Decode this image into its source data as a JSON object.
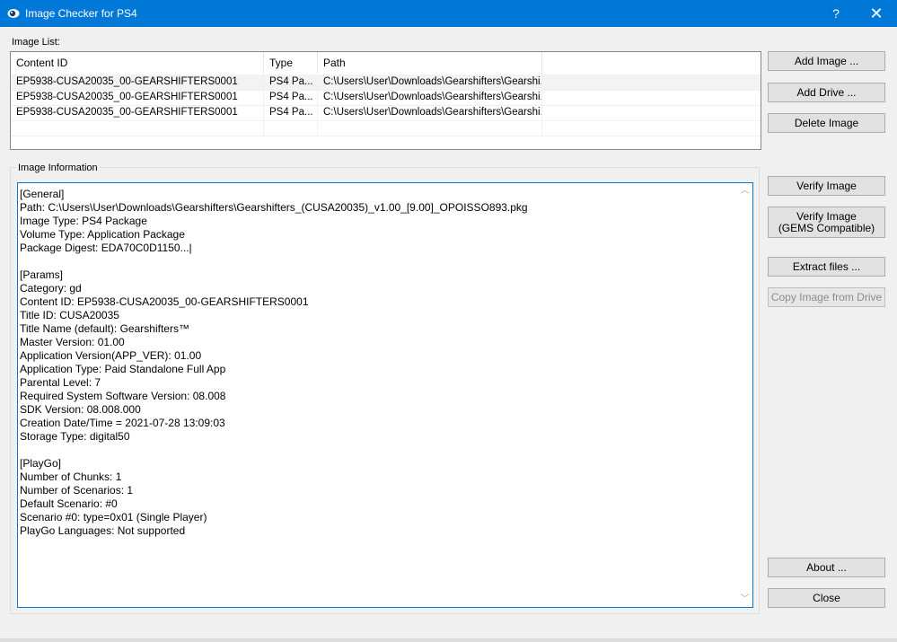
{
  "window": {
    "title": "Image Checker for PS4",
    "help_glyph": "?",
    "close_glyph": "✕",
    "icon": "app-eye-icon"
  },
  "image_list": {
    "label": "Image List:",
    "columns": [
      "Content ID",
      "Type",
      "Path"
    ],
    "rows": [
      {
        "content_id": "EP5938-CUSA20035_00-GEARSHIFTERS0001",
        "type": "PS4 Pa...",
        "path": "C:\\Users\\User\\Downloads\\Gearshifters\\Gearshi..."
      },
      {
        "content_id": "EP5938-CUSA20035_00-GEARSHIFTERS0001",
        "type": "PS4 Pa...",
        "path": "C:\\Users\\User\\Downloads\\Gearshifters\\Gearshi..."
      },
      {
        "content_id": "EP5938-CUSA20035_00-GEARSHIFTERS0001",
        "type": "PS4 Pa...",
        "path": "C:\\Users\\User\\Downloads\\Gearshifters\\Gearshi..."
      }
    ]
  },
  "image_information": {
    "label": "Image Information",
    "text": "[General]\nPath: C:\\Users\\User\\Downloads\\Gearshifters\\Gearshifters_(CUSA20035)_v1.00_[9.00]_OPOISSO893.pkg\nImage Type: PS4 Package\nVolume Type: Application Package\nPackage Digest: EDA70C0D1150...|\n\n[Params]\nCategory: gd\nContent ID: EP5938-CUSA20035_00-GEARSHIFTERS0001\nTitle ID: CUSA20035\nTitle Name (default): Gearshifters™\nMaster Version: 01.00\nApplication Version(APP_VER): 01.00\nApplication Type: Paid Standalone Full App\nParental Level: 7\nRequired System Software Version: 08.008\nSDK Version: 08.008.000\nCreation Date/Time = 2021-07-28 13:09:03\nStorage Type: digital50\n\n[PlayGo]\nNumber of Chunks: 1\nNumber of Scenarios: 1\nDefault Scenario: #0\nScenario #0: type=0x01 (Single Player)\nPlayGo Languages: Not supported"
  },
  "buttons": {
    "add_image": "Add Image ...",
    "add_drive": "Add Drive ...",
    "delete_image": "Delete Image",
    "verify_image": "Verify Image",
    "verify_image_gems_line1": "Verify Image",
    "verify_image_gems_line2": "(GEMS Compatible)",
    "extract_files": "Extract files ...",
    "copy_from_drive": "Copy Image from Drive",
    "about": "About ...",
    "close": "Close"
  },
  "colors": {
    "titlebar": "#0078d7",
    "window_bg": "#f0f0f0",
    "button_bg": "#e1e1e1"
  }
}
